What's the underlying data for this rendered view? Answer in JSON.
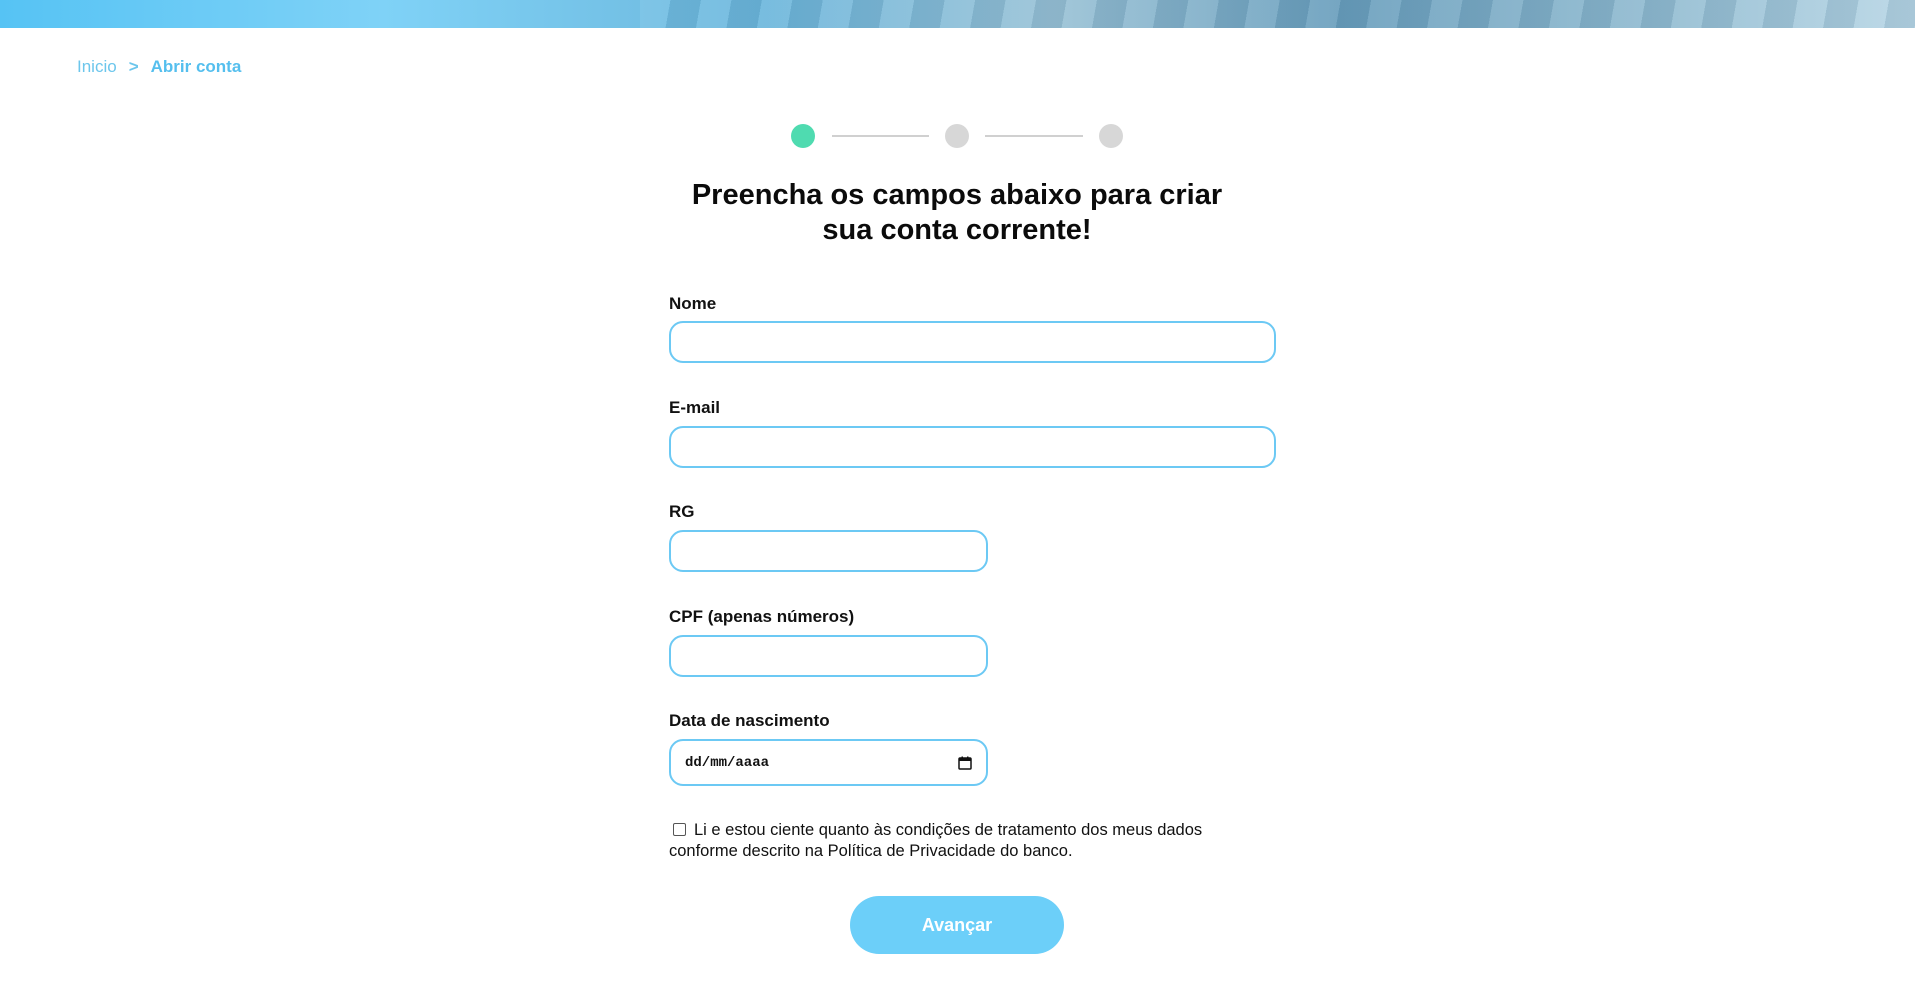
{
  "breadcrumb": {
    "home": "Inicio",
    "separator": ">",
    "current": "Abrir conta"
  },
  "stepper": {
    "total_steps": 3,
    "current_step": 1
  },
  "title": {
    "line1": "Preencha os campos abaixo para criar",
    "line2": "sua conta corrente!"
  },
  "form": {
    "nome": {
      "label": "Nome",
      "value": ""
    },
    "email": {
      "label": "E-mail",
      "value": ""
    },
    "rg": {
      "label": "RG",
      "value": ""
    },
    "cpf": {
      "label": "CPF (apenas números)",
      "value": ""
    },
    "nascimento": {
      "label": "Data de nascimento",
      "placeholder": "dd/mm/aaaa"
    }
  },
  "consent": {
    "checked": false,
    "text": "Li e estou ciente quanto às condições de tratamento dos meus dados conforme descrito na Política de Privacidade do banco."
  },
  "submit_label": "Avançar",
  "colors": {
    "accent": "#6ccff9",
    "input_border": "#6cc9f4",
    "step_active": "#4fdbb0",
    "step_inactive": "#d7d7d7",
    "breadcrumb": "#55bfee"
  }
}
